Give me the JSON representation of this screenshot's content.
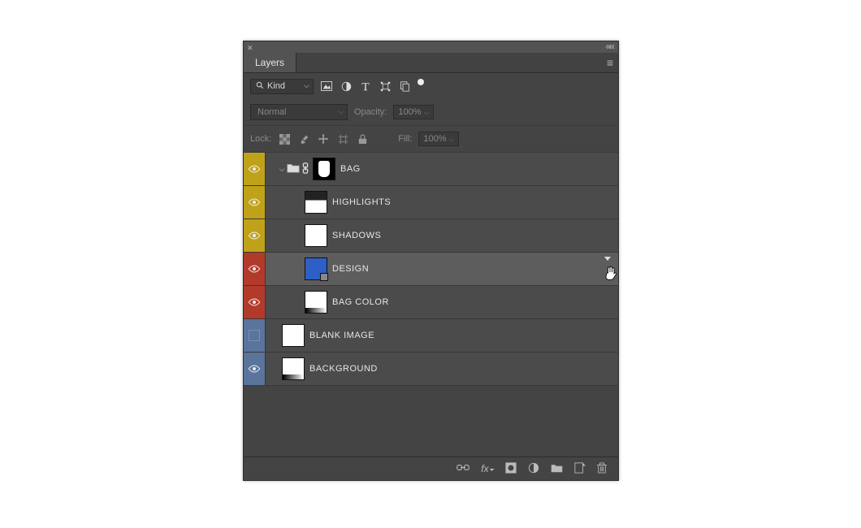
{
  "panel": {
    "title": "Layers"
  },
  "filter": {
    "kind_label": "Kind"
  },
  "mode": {
    "blend": "Normal",
    "opacity_label": "Opacity:",
    "opacity_value": "100%"
  },
  "lock": {
    "label": "Lock:",
    "fill_label": "Fill:",
    "fill_value": "100%"
  },
  "colors": {
    "gold": "#bfa21a",
    "red": "#b23a2a",
    "blue": "#5a749c"
  },
  "layers": [
    {
      "name": "BAG",
      "tag": "gold",
      "visible": true,
      "type": "group",
      "selected": false
    },
    {
      "name": "HIGHLIGHTS",
      "tag": "gold",
      "visible": true,
      "type": "layer",
      "indent": 1,
      "thumb": "darktop",
      "selected": false
    },
    {
      "name": "SHADOWS",
      "tag": "gold",
      "visible": true,
      "type": "layer",
      "indent": 1,
      "thumb": "plain",
      "selected": false
    },
    {
      "name": "DESIGN",
      "tag": "red",
      "visible": true,
      "type": "smart",
      "indent": 1,
      "thumb": "bluebox",
      "selected": true
    },
    {
      "name": "BAG COLOR",
      "tag": "red",
      "visible": true,
      "type": "layer",
      "indent": 1,
      "thumb": "grad",
      "selected": false
    },
    {
      "name": "BLANK IMAGE",
      "tag": "blue",
      "visible": false,
      "type": "layer",
      "indent": 0,
      "thumb": "plain",
      "selected": false
    },
    {
      "name": "BACKGROUND",
      "tag": "blue",
      "visible": true,
      "type": "layer",
      "indent": 0,
      "thumb": "grad",
      "selected": false
    }
  ]
}
